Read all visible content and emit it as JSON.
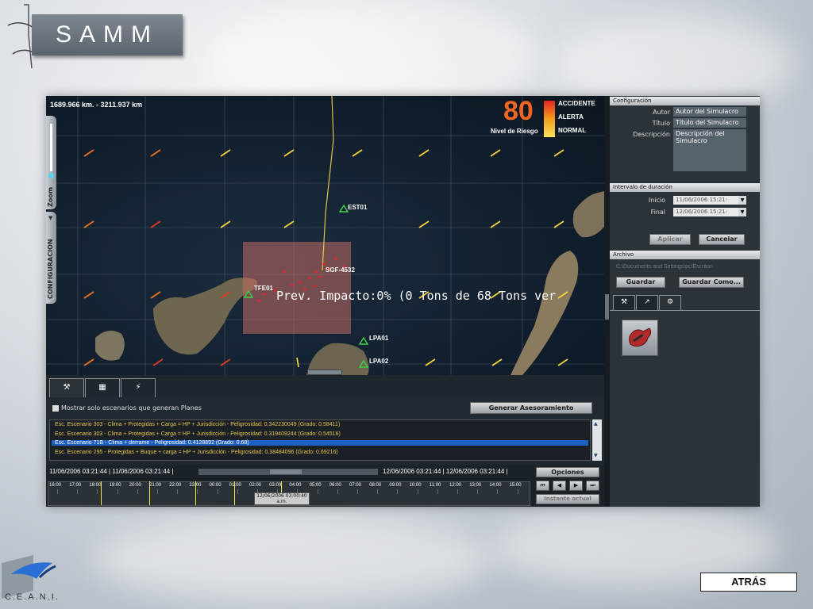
{
  "header": {
    "logo_text": "SAMM"
  },
  "map": {
    "scale_readout": "1689.966 km. - 3211.937 km",
    "risk_level": "80",
    "risk_label": "Nivel de Riesgo",
    "legend": [
      "ACCIDENTE",
      "ALERTA",
      "NORMAL"
    ],
    "vessel_label": "SGF-4532",
    "impact_text": "Prev. Impacto:0% (0 Tons de 68 Tons ver",
    "stations": [
      "EST01",
      "TFE01",
      "LPA01",
      "LPA02"
    ],
    "zoom_label": "Zoom",
    "config_tab_label": "CONFIGURACION",
    "colors": {
      "accident": "#e52420",
      "alert": "#f39c1d",
      "normal": "#fbe35a",
      "spill": "#e8141b"
    }
  },
  "config": {
    "header": "Configuración",
    "author_label": "Autor",
    "author_value": "Autor del Simulacro",
    "title_label": "Título",
    "title_value": "Título del Simulacro",
    "description_label": "Descripción",
    "description_value": "Descripción del Simulacro"
  },
  "interval": {
    "header": "Intervalo de duración",
    "start_label": "Inicio",
    "start_value": "11/06/2006 15:21:",
    "end_label": "Final",
    "end_value": "12/06/2006 15:21:",
    "apply_label": "Aplicar",
    "cancel_label": "Cancelar"
  },
  "archive": {
    "header": "Archivo",
    "path_placeholder": "C:\\Documents and Settings\\pc\\Escritori",
    "save_label": "Guardar",
    "save_as_label": "Guardar Como..."
  },
  "scenarios": {
    "filter_label": "Mostrar solo escenarios que generan Planes",
    "advise_button": "Generar Asesoramiento",
    "rows": [
      {
        "text": "Esc. Escenario 303 - Clima + Protegidas + Carga = HP + Jurisdicción - Peligrosidad: 0.342230049 (Grado: 0.58411)",
        "selected": false
      },
      {
        "text": "Esc. Escenario 303 - Clima + Protegidas + Carga = HP + Jurisdicción - Peligrosidad: 0.319409244 (Grado: 0.54516)",
        "selected": false
      },
      {
        "text": "Esc. Escenario 71B - Clima + derrame - Peligrosidad: 0.4128892 (Grado: 0.68)",
        "selected": true
      },
      {
        "text": "Esc. Escenario 295 - Protegidas + Buque + carga = HP + Jurisdicción - Peligrosidad: 0.38484096 (Grado: 0.69216)",
        "selected": false
      }
    ]
  },
  "timeline": {
    "range_left": "11/06/2006 03:21:44 | 11/06/2006 03:21:44 |",
    "range_right": "12/06/2006 03:21:44 | 12/06/2006 03:21:44 |",
    "options_label": "Opciones",
    "current_time": "12/06/2006 03:00:40",
    "current_time_suffix": "a.m.",
    "now_button": "Instante actual",
    "ticks": [
      "16:00",
      "17:00",
      "18:00",
      "19:00",
      "20:00",
      "21:00",
      "22:00",
      "23:00",
      "00:00",
      "01:00",
      "02:00",
      "03:00",
      "04:00",
      "05:00",
      "06:00",
      "07:00",
      "08:00",
      "09:00",
      "10:00",
      "11:00",
      "12:00",
      "13:00",
      "14:00",
      "15:00"
    ]
  },
  "footer": {
    "back_button": "ATRÁS",
    "org_name": "C.E.A.N.I."
  }
}
